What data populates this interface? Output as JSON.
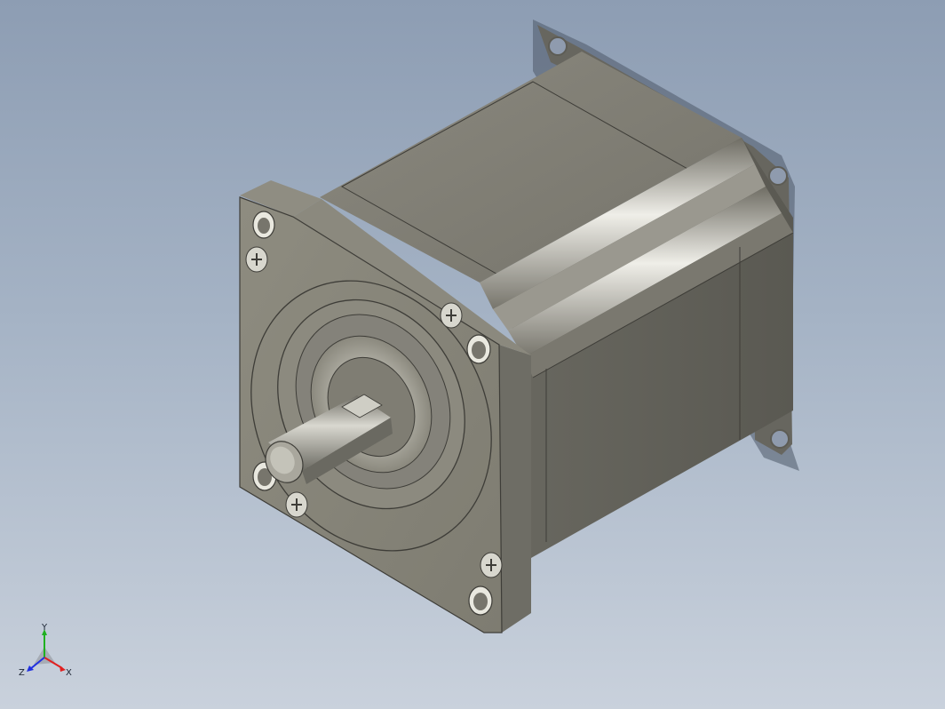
{
  "viewport": {
    "content": "stepper-motor-3d-model"
  },
  "triad": {
    "x_label": "X",
    "y_label": "Y",
    "z_label": "Z",
    "colors": {
      "x": "#e02020",
      "y": "#20b020",
      "z": "#2030e0"
    }
  },
  "model": {
    "colors": {
      "body": "#7d7b71",
      "body_dark": "#5f5e57",
      "flange": "#8a887c",
      "highlight": "#ecebe4",
      "shaft": "#8c8a80",
      "shadow": "#55606f"
    }
  }
}
